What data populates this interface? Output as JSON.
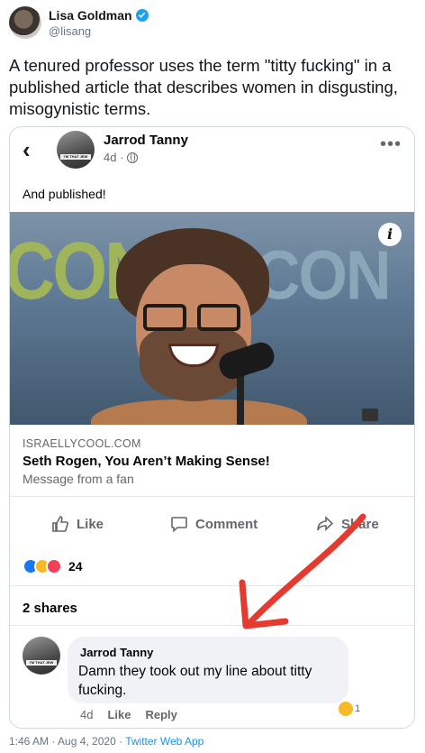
{
  "tweet": {
    "author_name": "Lisa Goldman",
    "author_handle": "@lisang",
    "text": "A tenured professor uses the term \"titty fucking\" in a published article that describes women in disgusting, misogynistic terms.",
    "timestamp": "1:46 AM · Aug 4, 2020 · ",
    "source": "Twitter Web App"
  },
  "fb_post": {
    "author_name": "Jarrod Tanny",
    "time": "4d ·",
    "avatar_tag": "I'M THAT JEW",
    "text": "And published!",
    "image_left_text": "CON",
    "image_right_text": "CON",
    "link_domain": "ISRAELLYCOOL.COM",
    "link_title": "Seth Rogen, You Aren’t Making Sense!",
    "link_desc": "Message from a fan",
    "actions": {
      "like": "Like",
      "comment": "Comment",
      "share": "Share"
    },
    "reaction_count": "24",
    "shares": "2 shares"
  },
  "comment": {
    "author_name": "Jarrod Tanny",
    "avatar_tag": "I'M THAT JEW",
    "text": "Damn they took out my line about titty fucking.",
    "time": "4d",
    "like_label": "Like",
    "reply_label": "Reply",
    "reaction_count": "1"
  },
  "colors": {
    "twitter_blue": "#1da1f2",
    "fb_like_blue": "#1877f2",
    "annotation_red": "#e53a2f"
  },
  "icons": [
    "verified-icon",
    "back-icon",
    "globe-icon",
    "more-icon",
    "info-icon",
    "like-icon",
    "comment-icon",
    "share-icon",
    "arrow-annotation"
  ]
}
